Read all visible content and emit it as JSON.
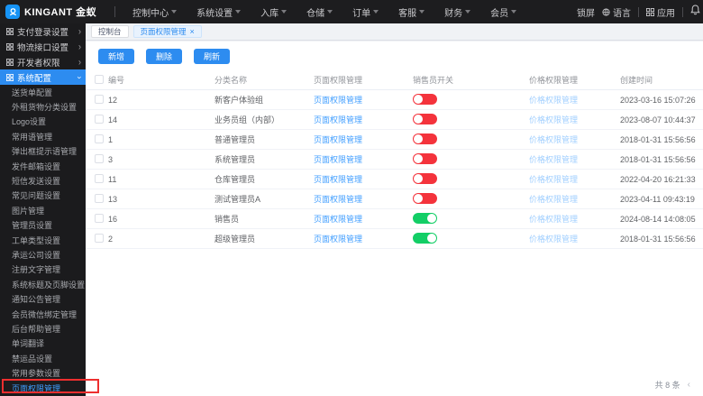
{
  "navbar": {
    "brand": "KINGANT 金蚁",
    "menu": [
      {
        "label": "控制中心"
      },
      {
        "label": "系统设置"
      },
      {
        "label": "入库"
      },
      {
        "label": "仓储"
      },
      {
        "label": "订单"
      },
      {
        "label": "客服"
      },
      {
        "label": "财务"
      },
      {
        "label": "会员"
      }
    ],
    "lock": "锁屏",
    "language": "语言",
    "apps": "应用"
  },
  "sidebar": {
    "top_items": [
      {
        "label": "支付登录设置",
        "expanded": false
      },
      {
        "label": "物流接口设置",
        "expanded": false
      },
      {
        "label": "开发者权限",
        "expanded": false
      },
      {
        "label": "系统配置",
        "expanded": true
      }
    ],
    "sub_items": [
      {
        "label": "送货单配置",
        "active": false
      },
      {
        "label": "外租货物分类设置",
        "active": false
      },
      {
        "label": "Logo设置",
        "active": false
      },
      {
        "label": "常用语管理",
        "active": false
      },
      {
        "label": "弹出框提示语管理",
        "active": false
      },
      {
        "label": "发件邮箱设置",
        "active": false
      },
      {
        "label": "短信发送设置",
        "active": false
      },
      {
        "label": "常见问题设置",
        "active": false
      },
      {
        "label": "图片管理",
        "active": false
      },
      {
        "label": "管理员设置",
        "active": false
      },
      {
        "label": "工单类型设置",
        "active": false
      },
      {
        "label": "承运公司设置",
        "active": false
      },
      {
        "label": "注册文字管理",
        "active": false
      },
      {
        "label": "系统标题及页脚设置",
        "active": false
      },
      {
        "label": "通知公告管理",
        "active": false
      },
      {
        "label": "会员微信绑定管理",
        "active": false
      },
      {
        "label": "后台帮助管理",
        "active": false
      },
      {
        "label": "单词翻译",
        "active": false
      },
      {
        "label": "禁运品设置",
        "active": false
      },
      {
        "label": "常用参数设置",
        "active": false
      },
      {
        "label": "页面权限管理",
        "active": true
      }
    ]
  },
  "tabs": [
    {
      "label": "控制台",
      "active": false,
      "closable": false
    },
    {
      "label": "页面权限管理",
      "active": true,
      "closable": true
    }
  ],
  "toolbar": {
    "add": "新增",
    "delete": "删除",
    "refresh": "刷新"
  },
  "table": {
    "headers": {
      "id": "编号",
      "name": "分类名称",
      "page_perm": "页面权限管理",
      "sales_switch": "销售员开关",
      "price_perm": "价格权限管理",
      "created": "创建时间"
    },
    "page_link_label": "页面权限管理",
    "price_link_label": "价格权限管理",
    "rows": [
      {
        "id": "12",
        "name": "新客户体验组",
        "switch_on": false,
        "created": "2023-03-16 15:07:26"
      },
      {
        "id": "14",
        "name": "业务员组（内部）",
        "switch_on": false,
        "created": "2023-08-07 10:44:37"
      },
      {
        "id": "1",
        "name": "普通管理员",
        "switch_on": false,
        "created": "2018-01-31 15:56:56"
      },
      {
        "id": "3",
        "name": "系统管理员",
        "switch_on": false,
        "created": "2018-01-31 15:56:56"
      },
      {
        "id": "11",
        "name": "仓库管理员",
        "switch_on": false,
        "created": "2022-04-20 16:21:33"
      },
      {
        "id": "13",
        "name": "测试管理员A",
        "switch_on": false,
        "created": "2023-04-11 09:43:19"
      },
      {
        "id": "16",
        "name": "销售员",
        "switch_on": true,
        "created": "2024-08-14 14:08:05"
      },
      {
        "id": "2",
        "name": "超级管理员",
        "switch_on": true,
        "created": "2018-01-31 15:56:56"
      }
    ]
  },
  "pagination": {
    "total": "共 8 条",
    "prev_arrow": "‹"
  },
  "colors": {
    "accent_blue": "#2d8cf0",
    "link_blue": "#409eff",
    "link_light_blue": "#a0cfff",
    "switch_off_red": "#f4333c",
    "switch_on_green": "#13ce66",
    "navbar_bg": "#1d1d1f",
    "sidebar_bg": "#1b1b1d",
    "annotation_red": "#ed2f2f"
  }
}
